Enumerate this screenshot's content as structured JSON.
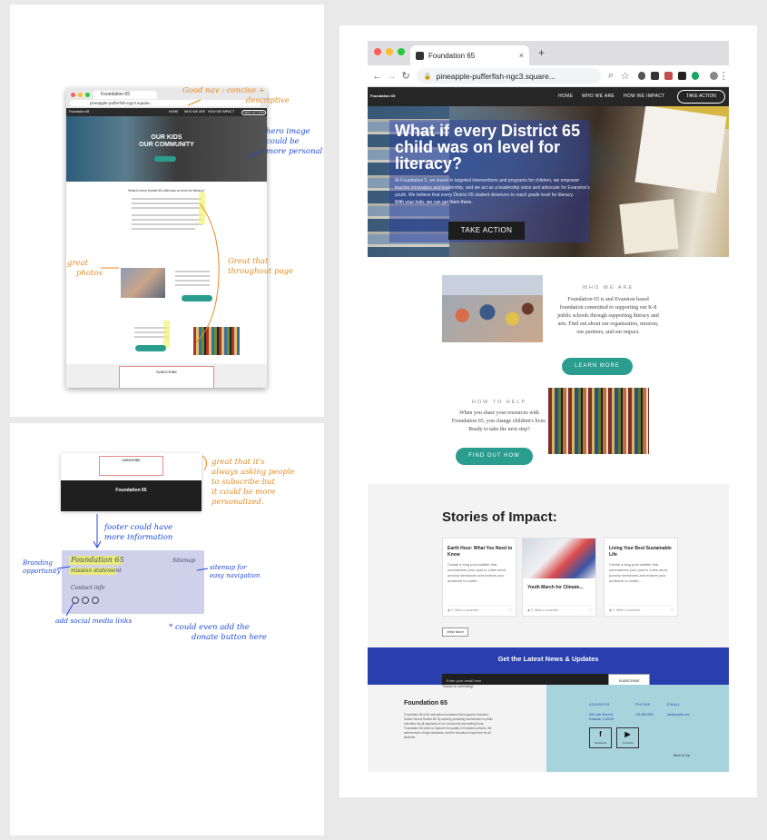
{
  "colors": {
    "accent_teal": "#2a9d8f",
    "newsletter_blue": "#2a3fae",
    "footer_teal": "#a7d3dc",
    "annotation_orange": "#e6891f",
    "annotation_blue": "#1f4bd6"
  },
  "mini_browser": {
    "tab_title": "Foundation 65",
    "url": "pineapple-pufferfish-ngc3.square...",
    "nav": [
      "HOME",
      "WHO WE ARE",
      "HOW WE IMPACT",
      "TAKE ACTION"
    ],
    "logo": "Foundation 65",
    "hero_title": [
      "OUR KIDS",
      "OUR COMMUNITY"
    ],
    "intro_heading": "What if every District 65 child was on level for literacy?",
    "subscribe": "SUBSCRIBE"
  },
  "annotations_top": {
    "good_nav": "Good nav : concise +",
    "good_nav_2": "descriptive",
    "hero_image": "hero image",
    "hero_image_2": "could be",
    "hero_image_3": "more personal",
    "great_photos": "great",
    "great_photos_2": "photos",
    "great_text": "Great that",
    "great_text_2": "throughout page"
  },
  "annotations_bottom": {
    "subscribe_note": "great that it's",
    "subscribe_note_2": "always asking people",
    "subscribe_note_3": "to subscribe but",
    "subscribe_note_4": "it could be more",
    "subscribe_note_5": "personalized.",
    "footer_note": "footer could have",
    "footer_note_2": "more information",
    "branding": "Branding",
    "branding_2": "opportunity",
    "sitemap": "sitemap for",
    "sitemap_2": "easy navigation",
    "social": "add social media links",
    "donate": "* could even add the",
    "donate_2": "donate button here",
    "sketch_title": "Foundation 65",
    "sketch_sub": "mission statement",
    "sketch_contact": "Contact info",
    "sketch_sitemap": "Sitemap",
    "bl_footer_title": "Foundation 65",
    "bl_subscribe": "SUBSCRIBE"
  },
  "browser": {
    "tab_title": "Foundation 65",
    "url": "pineapple-pufferfish-ngc3.square...",
    "new_tab": "+",
    "close_tab": "×"
  },
  "site": {
    "logo": "Foundation 65",
    "nav": {
      "home": "HOME",
      "who": "WHO WE ARE",
      "how": "HOW WE IMPACT",
      "take_action": "TAKE ACTION"
    },
    "hero": {
      "title": "What if every District 65 child was on level for literacy?",
      "text": "At Foundation 5, we invest in targeted interventions and programs for children, we empower teacher innovation and leadership, and we act as a leadership voice and advocate for Evanston's youth. We believe that every District 65 student deserves to reach grade level for literacy.",
      "text_bold": "With your help, we can get them there.",
      "button": "TAKE ACTION"
    },
    "who": {
      "heading": "WHO WE ARE",
      "text": "Foundation 65 is and Evanston based foundation committed to supporting our K-8 public schools through supporting literacy and arts. Find out about our organization, mission, our partners, and our impact.",
      "button": "LEARN MORE"
    },
    "help": {
      "heading": "HOW TO HELP",
      "text": "When you share your resources with Foundation 65, you change children's lives. Ready to take the next step?",
      "button": "FIND OUT HOW"
    },
    "stories": {
      "title": "Stories of Impact:",
      "cards": [
        {
          "title": "Earth Hour: What You Need to Know",
          "text": "Create a blog post subtitle that summarizes your post in a few short, punchy sentences and entices your audience to contin...",
          "views": "0",
          "comment": "Write a comment"
        },
        {
          "title": "Youth March for Climate...",
          "text": "",
          "views": "0",
          "comment": "Write a comment"
        },
        {
          "title": "Living Your Best Sustainable Life",
          "text": "Create a blog post subtitle that summarizes your post in a few short, punchy sentences and entices your audience to contin...",
          "views": "0",
          "comment": "Write a comment"
        }
      ],
      "view_more": "View More"
    },
    "newsletter": {
      "title": "Get the Latest News & Updates",
      "placeholder": "Enter your email here",
      "button": "SUBSCRIBE",
      "thanks": "Thanks for submitting!"
    },
    "footer": {
      "title": "Foundation 65",
      "text": "Foundation 65 is the education foundation that supports Evanston-Skokie School District 65. By actively promoting involvement in public education by all segments of our community and raising funds, Foundation 65 seeks to improve the quality of Evanston schools, the achievement of high standards, and the education experience for all students.",
      "address_h": "ADDRESS",
      "address": "500 Lake Shore Bl.\nEvanston, IL 60201",
      "phone_h": "PHONE",
      "phone": "123-456-7890",
      "email_h": "EMAIL",
      "email": "info@mysite.com",
      "facebook": "Facebook",
      "youtube": "YouTube",
      "back_top": "Back to Top"
    }
  }
}
